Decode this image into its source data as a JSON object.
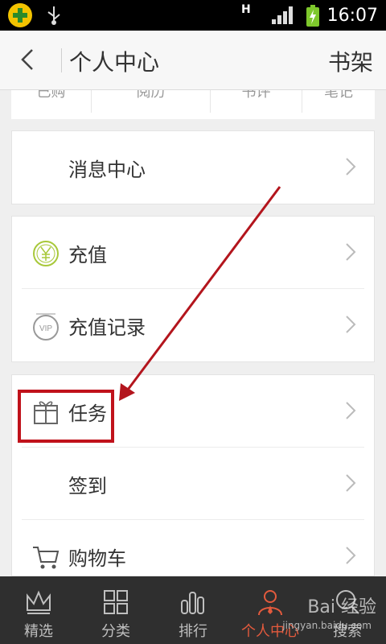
{
  "status_bar": {
    "time": "16:07",
    "network": "H"
  },
  "title_bar": {
    "title": "个人中心",
    "right_action": "书架"
  },
  "subtabs": [
    "已购",
    "阅历",
    "书评",
    "笔记"
  ],
  "menu": {
    "group1": [
      {
        "label": "消息中心"
      }
    ],
    "group2": [
      {
        "label": "充值"
      },
      {
        "label": "充值记录"
      }
    ],
    "group3": [
      {
        "label": "任务"
      },
      {
        "label": "签到"
      },
      {
        "label": "购物车"
      }
    ]
  },
  "bottom_nav": [
    {
      "label": "精选",
      "icon": "crown-icon"
    },
    {
      "label": "分类",
      "icon": "grid-icon"
    },
    {
      "label": "排行",
      "icon": "bar-chart-icon"
    },
    {
      "label": "个人中心",
      "icon": "person-icon",
      "active": true
    },
    {
      "label": "搜索",
      "icon": "search-icon"
    }
  ],
  "watermark": {
    "text": "Bai 经验",
    "sub": "jingyan.baidu.com"
  },
  "colors": {
    "highlight": "#c0121b",
    "accent": "#e35a3d",
    "nav_bg": "#2f2f2f"
  }
}
